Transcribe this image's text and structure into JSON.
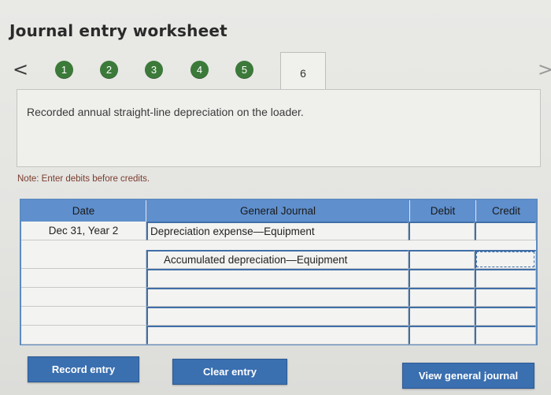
{
  "header": {
    "title": "Journal entry worksheet"
  },
  "nav": {
    "prev": "<",
    "next": ">",
    "steps": [
      "1",
      "2",
      "3",
      "4",
      "5"
    ],
    "active_step": "6"
  },
  "description": "Recorded annual straight-line depreciation on the loader.",
  "note": "Note: Enter debits before credits.",
  "journal": {
    "columns": {
      "date": "Date",
      "account": "General Journal",
      "debit": "Debit",
      "credit": "Credit"
    },
    "rows": [
      {
        "date": "Dec 31, Year 2",
        "account": "Depreciation expense—Equipment",
        "debit": "",
        "credit": ""
      },
      {
        "date": "",
        "account": "Accumulated depreciation—Equipment",
        "debit": "",
        "credit": ""
      },
      {
        "date": "",
        "account": "",
        "debit": "",
        "credit": ""
      },
      {
        "date": "",
        "account": "",
        "debit": "",
        "credit": ""
      },
      {
        "date": "",
        "account": "",
        "debit": "",
        "credit": ""
      },
      {
        "date": "",
        "account": "",
        "debit": "",
        "credit": ""
      }
    ]
  },
  "buttons": {
    "record": "Record entry",
    "clear": "Clear entry",
    "view": "View general journal"
  },
  "colors": {
    "step_green": "#3c7a3a",
    "header_blue": "#5f8fcd",
    "button_blue": "#3a6fb0"
  }
}
